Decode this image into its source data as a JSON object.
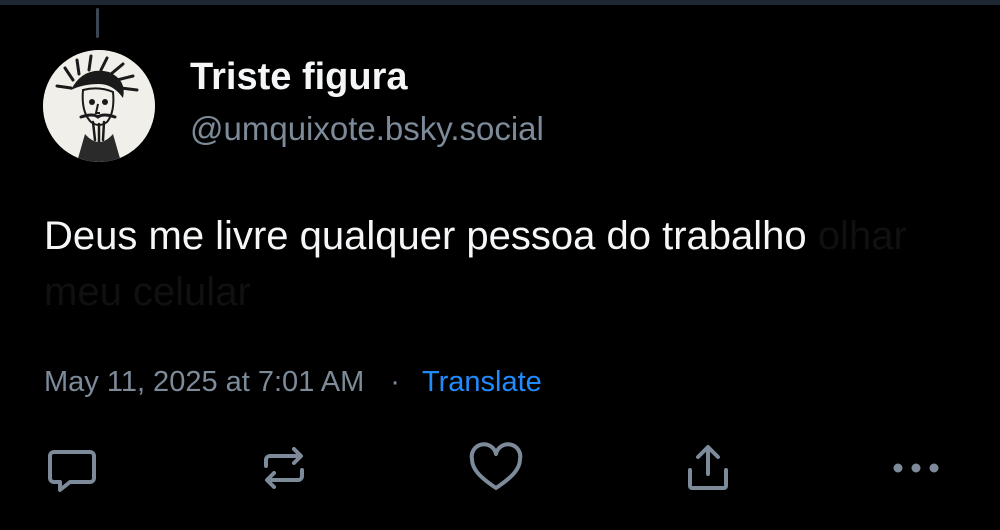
{
  "post": {
    "author": {
      "display_name": "Triste figura",
      "handle": "@umquixote.bsky.social",
      "avatar": "avatar-sketch-portrait"
    },
    "text_visible": "Deus me livre qualquer pessoa do trabalho",
    "text_faded": "olhar meu celular",
    "timestamp": "May 11, 2025 at 7:01 AM",
    "separator": "·",
    "translate_label": "Translate"
  },
  "actions": [
    {
      "name": "reply",
      "icon": "reply-icon"
    },
    {
      "name": "repost",
      "icon": "repost-icon"
    },
    {
      "name": "like",
      "icon": "heart-icon"
    },
    {
      "name": "share",
      "icon": "share-icon"
    },
    {
      "name": "more",
      "icon": "more-icon"
    }
  ],
  "colors": {
    "background": "#000000",
    "text_primary": "#f4f6f8",
    "text_secondary": "#7d8a99",
    "accent": "#208bfe",
    "icon": "#7d8a99"
  }
}
